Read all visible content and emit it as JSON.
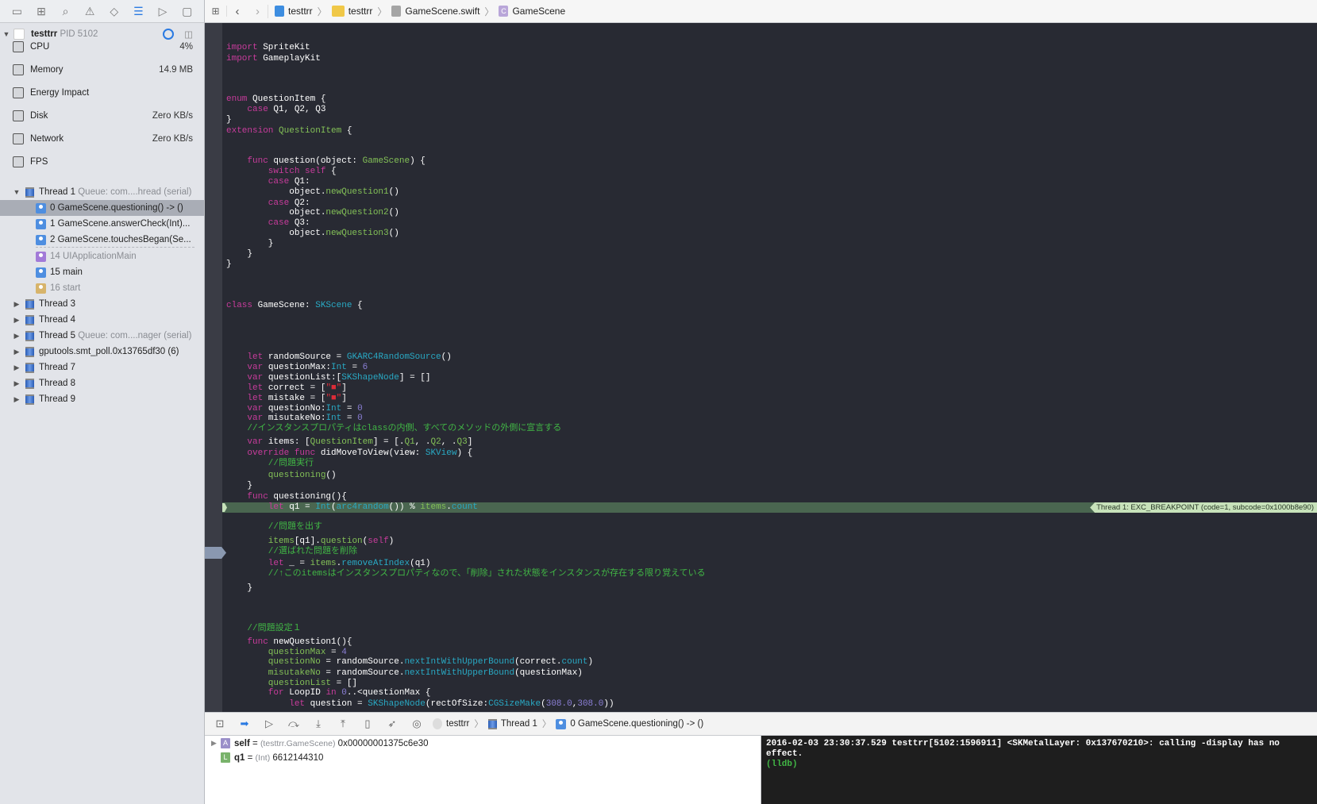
{
  "navigator_toolbar": {
    "icons": [
      "folder-icon",
      "hierarchy-icon",
      "search-icon",
      "warning-icon",
      "test-icon",
      "debug-navigator-icon",
      "breakpoint-icon",
      "report-icon"
    ],
    "active": "debug-navigator-icon"
  },
  "process": {
    "name": "testtrr",
    "pid": "PID 5102"
  },
  "gauges": [
    {
      "label": "CPU",
      "value": "4%",
      "icon": "cpu-icon"
    },
    {
      "label": "Memory",
      "value": "14.9 MB",
      "icon": "memory-icon"
    },
    {
      "label": "Energy Impact",
      "value": "",
      "icon": "battery-icon"
    },
    {
      "label": "Disk",
      "value": "Zero KB/s",
      "icon": "disk-icon"
    },
    {
      "label": "Network",
      "value": "Zero KB/s",
      "icon": "network-icon"
    },
    {
      "label": "FPS",
      "value": "",
      "icon": "fps-icon"
    }
  ],
  "thread1": {
    "label": "Thread 1",
    "queue": "Queue: com....hread (serial)"
  },
  "frames": [
    {
      "label": "0 GameScene.questioning() -> ()",
      "kind": "user",
      "selected": true
    },
    {
      "label": "1 GameScene.answerCheck(Int)...",
      "kind": "user"
    },
    {
      "label": "2 GameScene.touchesBegan(Se...",
      "kind": "user"
    },
    {
      "label": "14 UIApplicationMain",
      "kind": "framework"
    },
    {
      "label": "15 main",
      "kind": "user"
    },
    {
      "label": "16 start",
      "kind": "system"
    }
  ],
  "threads": [
    {
      "label": "Thread 3",
      "queue": ""
    },
    {
      "label": "Thread 4",
      "queue": ""
    },
    {
      "label": "Thread 5",
      "queue": "Queue: com....nager (serial)"
    },
    {
      "label": "gputools.smt_poll.0x13765df30 (6)",
      "queue": ""
    },
    {
      "label": "Thread 7",
      "queue": ""
    },
    {
      "label": "Thread 8",
      "queue": ""
    },
    {
      "label": "Thread 9",
      "queue": ""
    }
  ],
  "breadcrumb": [
    "testtrr",
    "testtrr",
    "GameScene.swift",
    "GameScene"
  ],
  "breakpoint_note": "Thread 1: EXC_BREAKPOINT (code=1, subcode=0x1000b8e90)",
  "code": {
    "lines": [
      [
        [
          "k",
          "import"
        ],
        [
          "p",
          " SpriteKit"
        ]
      ],
      [
        [
          "k",
          "import"
        ],
        [
          "p",
          " GameplayKit"
        ]
      ],
      [
        [
          "k",
          "enum"
        ],
        [
          "p",
          " QuestionItem {"
        ]
      ],
      [
        [
          "k",
          "    case"
        ],
        [
          "p",
          " Q1, Q2, Q3"
        ]
      ],
      [
        [
          "p",
          "}"
        ]
      ],
      [
        [
          "k",
          "extension"
        ],
        [
          "p",
          " "
        ],
        [
          "t",
          "QuestionItem"
        ],
        [
          "p",
          " {"
        ]
      ],
      [
        [
          "k",
          "    func"
        ],
        [
          "p",
          " question(object: "
        ],
        [
          "t",
          "GameScene"
        ],
        [
          "p",
          ") {"
        ]
      ],
      [
        [
          "k",
          "        switch self"
        ],
        [
          "p",
          " {"
        ]
      ],
      [
        [
          "k",
          "        case"
        ],
        [
          "p",
          " Q1:"
        ]
      ],
      [
        [
          "p",
          "            object."
        ],
        [
          "t",
          "newQuestion1"
        ],
        [
          "p",
          "()"
        ]
      ],
      [
        [
          "k",
          "        case"
        ],
        [
          "p",
          " Q2:"
        ]
      ],
      [
        [
          "p",
          "            object."
        ],
        [
          "t",
          "newQuestion2"
        ],
        [
          "p",
          "()"
        ]
      ],
      [
        [
          "k",
          "        case"
        ],
        [
          "p",
          " Q3:"
        ]
      ],
      [
        [
          "p",
          "            object."
        ],
        [
          "t",
          "newQuestion3"
        ],
        [
          "p",
          "()"
        ]
      ],
      [
        [
          "p",
          "        }"
        ]
      ],
      [
        [
          "p",
          "    }"
        ]
      ],
      [
        [
          "p",
          "}"
        ]
      ],
      [
        [
          "k",
          "class"
        ],
        [
          "p",
          " GameScene: "
        ],
        [
          "s",
          "SKScene"
        ],
        [
          "p",
          " {"
        ]
      ],
      [
        [
          "k",
          "    let"
        ],
        [
          "p",
          " randomSource = "
        ],
        [
          "s",
          "GKARC4RandomSource"
        ],
        [
          "p",
          "()"
        ]
      ],
      [
        [
          "k",
          "    var"
        ],
        [
          "p",
          " questionMax:"
        ],
        [
          "s",
          "Int"
        ],
        [
          "p",
          " = "
        ],
        [
          "n",
          "6"
        ]
      ],
      [
        [
          "k",
          "    var"
        ],
        [
          "p",
          " questionList:["
        ],
        [
          "s",
          "SKShapeNode"
        ],
        [
          "p",
          "] = []"
        ]
      ],
      [
        [
          "k",
          "    let"
        ],
        [
          "p",
          " correct = ["
        ],
        [
          "str",
          "\"■\""
        ],
        [
          "p",
          "]"
        ]
      ],
      [
        [
          "k",
          "    let"
        ],
        [
          "p",
          " mistake = ["
        ],
        [
          "str",
          "\"■\""
        ],
        [
          "p",
          "]"
        ]
      ],
      [
        [
          "k",
          "    var"
        ],
        [
          "p",
          " questionNo:"
        ],
        [
          "s",
          "Int"
        ],
        [
          "p",
          " = "
        ],
        [
          "n",
          "0"
        ]
      ],
      [
        [
          "k",
          "    var"
        ],
        [
          "p",
          " misutakeNo:"
        ],
        [
          "s",
          "Int"
        ],
        [
          "p",
          " = "
        ],
        [
          "n",
          "0"
        ]
      ],
      [
        [
          "c",
          "    //インスタンスプロパティはclassの内側、すべてのメソッドの外側に宣言する"
        ]
      ],
      [
        [
          "k",
          "    var"
        ],
        [
          "p",
          " items: ["
        ],
        [
          "t",
          "QuestionItem"
        ],
        [
          "p",
          "] = [."
        ],
        [
          "t",
          "Q1"
        ],
        [
          "p",
          ", ."
        ],
        [
          "t",
          "Q2"
        ],
        [
          "p",
          ", ."
        ],
        [
          "t",
          "Q3"
        ],
        [
          "p",
          "]"
        ]
      ],
      [
        [
          "k",
          "    override func"
        ],
        [
          "p",
          " didMoveToView(view: "
        ],
        [
          "s",
          "SKView"
        ],
        [
          "p",
          ") {"
        ]
      ],
      [
        [
          "c",
          "        //問題実行"
        ]
      ],
      [
        [
          "t",
          "        questioning"
        ],
        [
          "p",
          "()"
        ]
      ],
      [
        [
          "p",
          "    }"
        ]
      ],
      [
        [
          "k",
          "    func"
        ],
        [
          "p",
          " questioning(){"
        ]
      ],
      [
        [
          "k",
          "        let"
        ],
        [
          "p",
          " q1 = "
        ],
        [
          "s",
          "Int"
        ],
        [
          "p",
          "("
        ],
        [
          "s",
          "arc4random"
        ],
        [
          "p",
          "()) % "
        ],
        [
          "t",
          "items"
        ],
        [
          "p",
          "."
        ],
        [
          "s",
          "count"
        ]
      ],
      [
        [
          "c",
          "        //問題を出す"
        ]
      ],
      [
        [
          "t",
          "        items"
        ],
        [
          "p",
          "[q1]."
        ],
        [
          "t",
          "question"
        ],
        [
          "p",
          "("
        ],
        [
          "k",
          "self"
        ],
        [
          "p",
          ")"
        ]
      ],
      [
        [
          "c",
          "        //選ばれた問題を削除"
        ]
      ],
      [
        [
          "k",
          "        let"
        ],
        [
          "p",
          " _ = "
        ],
        [
          "t",
          "items"
        ],
        [
          "p",
          "."
        ],
        [
          "s",
          "removeAtIndex"
        ],
        [
          "p",
          "(q1)"
        ]
      ],
      [
        [
          "c",
          "        //↑このitemsはインスタンスプロパティなので、「削除」された状態をインスタンスが存在する限り覚えている"
        ]
      ],
      [
        [
          "p",
          "    }"
        ]
      ],
      [
        [
          "c",
          "    //問題設定１"
        ]
      ],
      [
        [
          "k",
          "    func"
        ],
        [
          "p",
          " newQuestion1(){"
        ]
      ],
      [
        [
          "t",
          "        questionMax"
        ],
        [
          "p",
          " = "
        ],
        [
          "n",
          "4"
        ]
      ],
      [
        [
          "t",
          "        questionNo"
        ],
        [
          "p",
          " = randomSource."
        ],
        [
          "s",
          "nextIntWithUpperBound"
        ],
        [
          "p",
          "(correct."
        ],
        [
          "s",
          "count"
        ],
        [
          "p",
          ")"
        ]
      ],
      [
        [
          "t",
          "        misutakeNo"
        ],
        [
          "p",
          " = randomSource."
        ],
        [
          "s",
          "nextIntWithUpperBound"
        ],
        [
          "p",
          "(questionMax)"
        ]
      ],
      [
        [
          "t",
          "        questionList"
        ],
        [
          "p",
          " = []"
        ]
      ],
      [
        [
          "k",
          "        for"
        ],
        [
          "p",
          " LoopID "
        ],
        [
          "k",
          "in"
        ],
        [
          "p",
          " "
        ],
        [
          "n",
          "0"
        ],
        [
          "p",
          "..<questionMax {"
        ]
      ],
      [
        [
          "k",
          "            let"
        ],
        [
          "p",
          " question = "
        ],
        [
          "s",
          "SKShapeNode"
        ],
        [
          "p",
          "(rectOfSize:"
        ],
        [
          "s",
          "CGSizeMake"
        ],
        [
          "p",
          "("
        ],
        [
          "n",
          "308.0"
        ],
        [
          "p",
          ","
        ],
        [
          "n",
          "308.0"
        ],
        [
          "p",
          "))"
        ]
      ]
    ]
  },
  "debug_bar": {
    "buttons": [
      "hide-debug-area-icon",
      "breakpoints-toggle-icon",
      "continue-icon",
      "step-over-icon",
      "step-into-icon",
      "step-out-icon",
      "view-debugger-icon",
      "simulate-location-icon",
      "camera-icon"
    ],
    "crumbs": [
      "testtrr",
      "Thread 1",
      "0 GameScene.questioning() -> ()"
    ]
  },
  "variables": [
    {
      "badge": "A",
      "name": "self",
      "type": "(testtrr.GameScene)",
      "value": "0x00000001375c6e30",
      "expandable": true
    },
    {
      "badge": "L",
      "name": "q1",
      "type": "(Int)",
      "value": "6612144310",
      "expandable": false
    }
  ],
  "console": {
    "log": "2016-02-03 23:30:37.529 testtrr[5102:1596911] <SKMetalLayer: 0x137670210>: calling -display has no effect.",
    "prompt": "(lldb)"
  },
  "colors": {
    "keyword": "#c83c9c",
    "project_symbol": "#83c057",
    "system_symbol": "#29a9c4",
    "number": "#8b7fd6",
    "comment": "#41b645",
    "string": "#db2c38",
    "breakpoint_line": "#4a6650",
    "accent": "#2a7ae2"
  }
}
